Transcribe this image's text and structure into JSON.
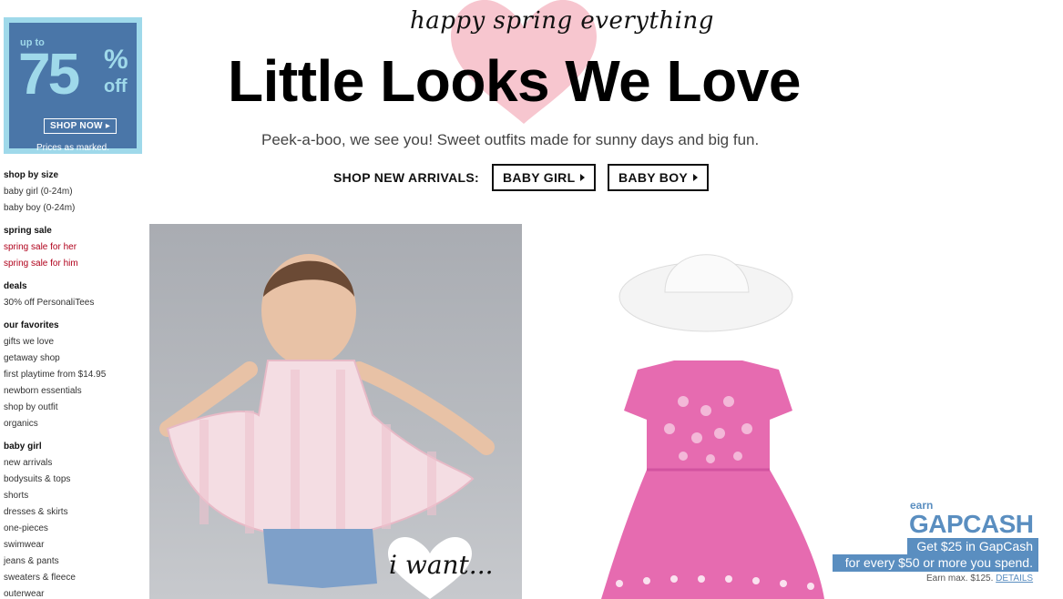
{
  "promo": {
    "upto": "up to",
    "big": "75",
    "pct": "%",
    "off": "off",
    "cta": "SHOP NOW",
    "note": "Prices as marked."
  },
  "sidebar": [
    {
      "heading": "shop by size",
      "links": [
        "baby girl (0-24m)",
        "baby boy (0-24m)"
      ]
    },
    {
      "heading": "spring sale",
      "links": [
        "spring sale for her",
        "spring sale for him"
      ],
      "accent": "#b0001b"
    },
    {
      "heading": "deals",
      "links": [
        "30% off PersonaliTees"
      ]
    },
    {
      "heading": "our favorites",
      "links": [
        "gifts we love",
        "getaway shop",
        "first playtime from $14.95",
        "newborn essentials",
        "shop by outfit",
        "organics"
      ]
    },
    {
      "heading": "baby girl",
      "links": [
        "new arrivals",
        "bodysuits & tops",
        "shorts",
        "dresses & skirts",
        "one-pieces",
        "swimwear",
        "jeans & pants",
        "sweaters & fleece",
        "outerwear"
      ]
    }
  ],
  "hero": {
    "script": "happy spring everything",
    "title": "Little Looks We Love",
    "subtitle": "Peek-a-boo, we see you! Sweet outfits made for sunny days and big fun.",
    "arrivals_label": "SHOP NEW ARRIVALS:",
    "btn_girl": "BABY GIRL",
    "btn_boy": "BABY BOY",
    "heart_color": "#f7c6cf"
  },
  "overlay": {
    "iwant": "i want..."
  },
  "gapcash": {
    "earn": "earn",
    "brand": "GAPCASH",
    "line1": "Get $25 in GapCash",
    "line2": "for every $50 or more you spend.",
    "fine": "Earn max. $125.",
    "details": "DETAILS",
    "color": "#5a8ec0"
  }
}
